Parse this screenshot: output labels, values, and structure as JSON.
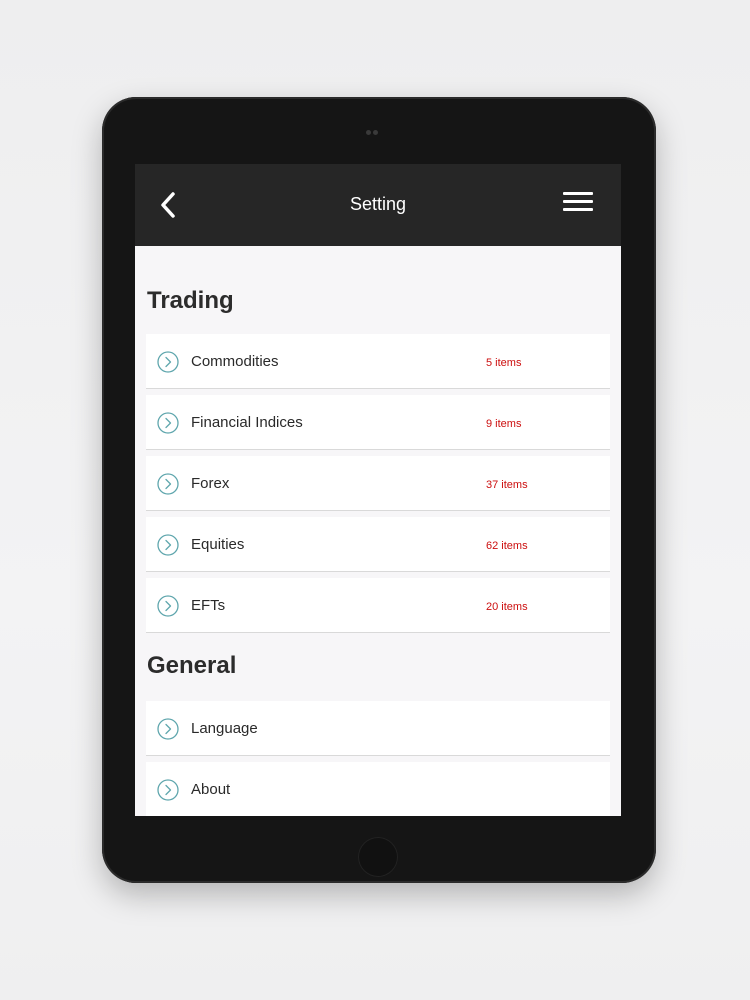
{
  "header": {
    "title": "Setting",
    "back_icon": "chevron-left-icon",
    "menu_icon": "hamburger-menu-icon"
  },
  "colors": {
    "header_bg": "#262626",
    "accent_icon": "#5fa6ad",
    "count_text": "#cc0e0e"
  },
  "sections": {
    "trading": {
      "title": "Trading",
      "items": [
        {
          "label": "Commodities",
          "count": "5 items"
        },
        {
          "label": "Financial Indices",
          "count": "9 items"
        },
        {
          "label": "Forex",
          "count": "37 items"
        },
        {
          "label": "Equities",
          "count": "62 items"
        },
        {
          "label": "EFTs",
          "count": "20 items"
        }
      ]
    },
    "general": {
      "title": "General",
      "items": [
        {
          "label": "Language"
        },
        {
          "label": "About"
        }
      ]
    }
  }
}
